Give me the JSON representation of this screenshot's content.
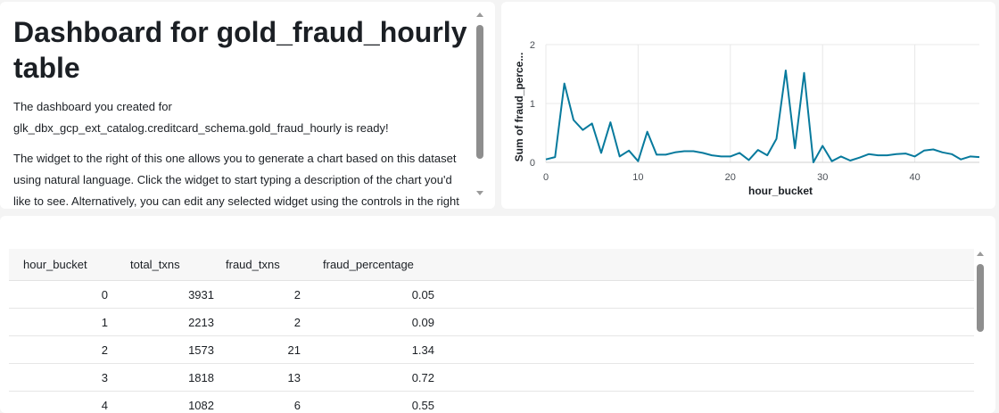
{
  "text_widget": {
    "title": "Dashboard for gold_fraud_hourly table",
    "paragraph1": "The dashboard you created for glk_dbx_gcp_ext_catalog.creditcard_schema.gold_fraud_hourly is ready!",
    "paragraph2": "The widget to the right of this one allows you to generate a chart based on this dataset using natural language. Click the widget to start typing a description of the chart you'd like to see. Alternatively, you can edit any selected widget using the controls in the right"
  },
  "chart_data": {
    "type": "line",
    "xlabel": "hour_bucket",
    "ylabel": "Sum of fraud_perce...",
    "xlim": [
      0,
      47
    ],
    "ylim": [
      0,
      2
    ],
    "xticks": [
      0,
      10,
      20,
      30,
      40
    ],
    "yticks": [
      0,
      1,
      2
    ],
    "grid": true,
    "color": "#077a9d",
    "x": [
      0,
      1,
      2,
      3,
      4,
      5,
      6,
      7,
      8,
      9,
      10,
      11,
      12,
      13,
      14,
      15,
      16,
      17,
      18,
      19,
      20,
      21,
      22,
      23,
      24,
      25,
      26,
      27,
      28,
      29,
      30,
      31,
      32,
      33,
      34,
      35,
      36,
      37,
      38,
      39,
      40,
      41,
      42,
      43,
      44,
      45,
      46,
      47
    ],
    "y": [
      0.05,
      0.09,
      1.34,
      0.72,
      0.55,
      0.66,
      0.16,
      0.68,
      0.1,
      0.2,
      0.02,
      0.52,
      0.13,
      0.13,
      0.17,
      0.19,
      0.19,
      0.16,
      0.12,
      0.1,
      0.1,
      0.16,
      0.04,
      0.21,
      0.12,
      0.4,
      1.56,
      0.24,
      1.52,
      0.0,
      0.28,
      0.02,
      0.1,
      0.03,
      0.08,
      0.14,
      0.12,
      0.12,
      0.14,
      0.15,
      0.1,
      0.2,
      0.22,
      0.17,
      0.14,
      0.05,
      0.1,
      0.09
    ]
  },
  "table": {
    "columns": [
      "hour_bucket",
      "total_txns",
      "fraud_txns",
      "fraud_percentage"
    ],
    "rows": [
      [
        "0",
        "3931",
        "2",
        "0.05"
      ],
      [
        "1",
        "2213",
        "2",
        "0.09"
      ],
      [
        "2",
        "1573",
        "21",
        "1.34"
      ],
      [
        "3",
        "1818",
        "13",
        "0.72"
      ],
      [
        "4",
        "1082",
        "6",
        "0.55"
      ]
    ]
  },
  "colors": {
    "line": "#077a9d",
    "background": "#f4f4f4",
    "card": "#ffffff"
  }
}
